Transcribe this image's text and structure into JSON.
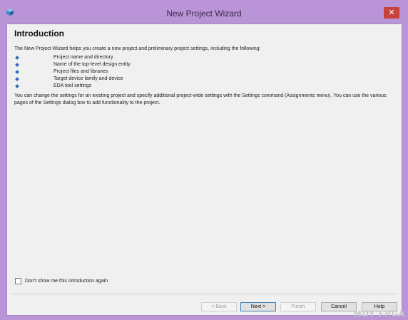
{
  "window": {
    "title": "New Project Wizard",
    "close_glyph": "✕",
    "app_icon": "quartus-cube-icon"
  },
  "page": {
    "heading": "Introduction",
    "intro": "The New Project Wizard helps you create a new project and preliminary project settings, including the following:",
    "bullets": [
      "Project name and directory",
      "Name of the top-level design entity",
      "Project files and libraries",
      "Target device family and device",
      "EDA tool settings"
    ],
    "settings_note": "You can change the settings for an existing project and specify additional project-wide settings with the Settings command (Assignments menu). You can use the various pages of the Settings dialog box to add functionality to the project."
  },
  "checkbox": {
    "label": "Don't show me this introduction again",
    "checked": false
  },
  "buttons": {
    "back": "< Back",
    "next": "Next >",
    "finish": "Finish",
    "cancel": "Cancel",
    "help": "Help"
  },
  "watermark": "MDY FPGA",
  "colors": {
    "title_bar": "#b995d8",
    "close_button": "#c8423d",
    "bullet": "#2d6bb7"
  }
}
